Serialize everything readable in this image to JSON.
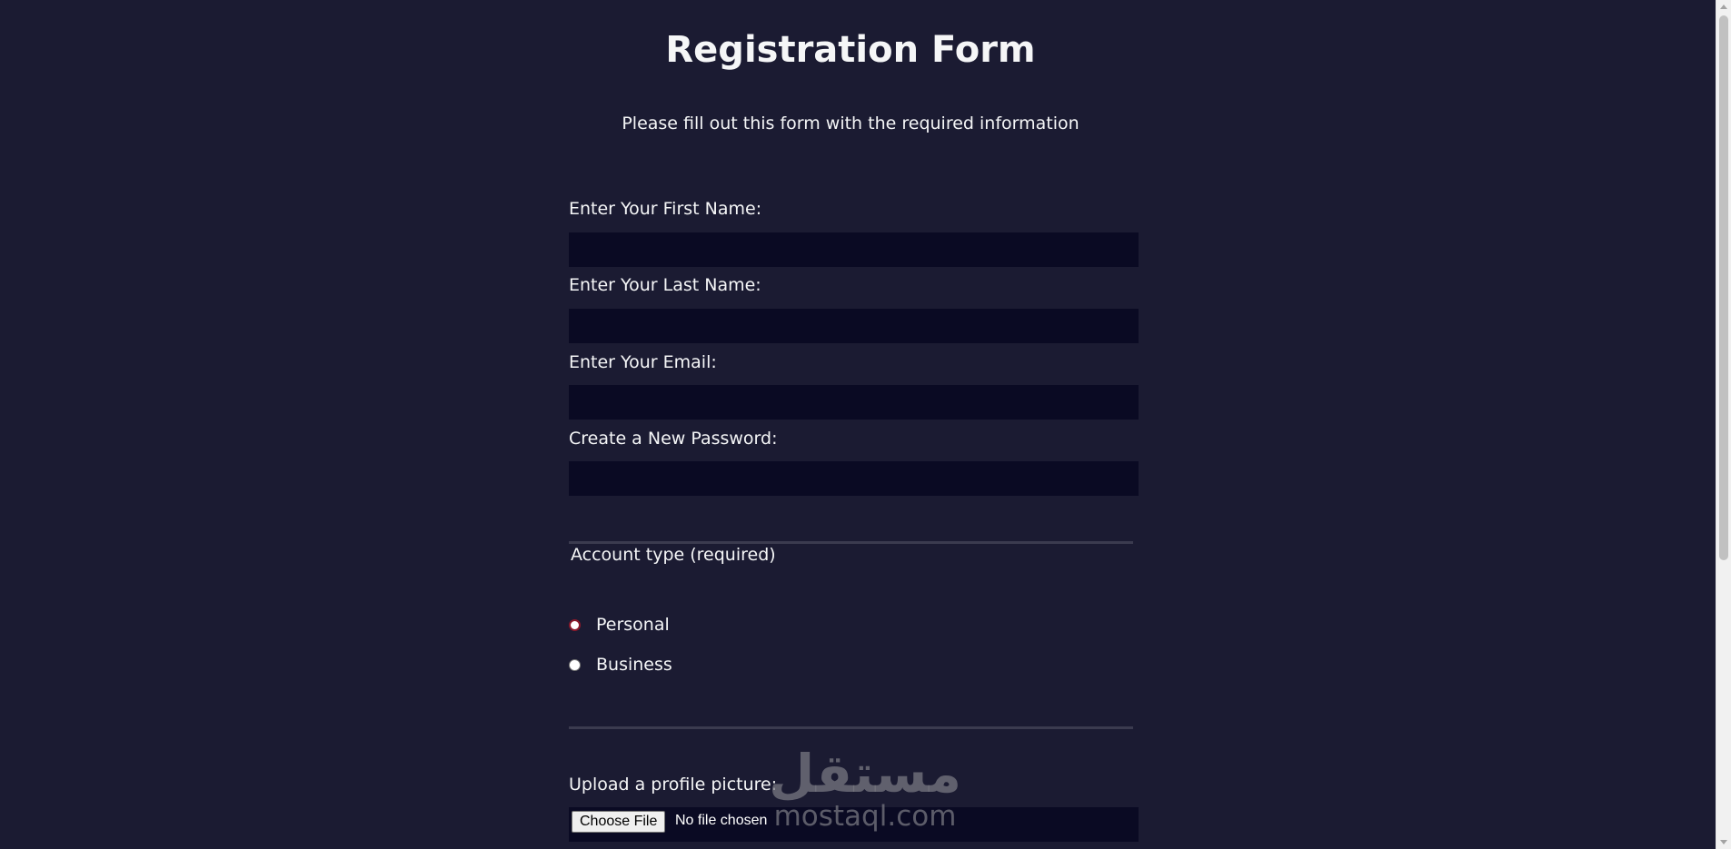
{
  "page": {
    "title": "Registration Form",
    "subtitle": "Please fill out this form with the required information"
  },
  "fields": {
    "first_name": {
      "label": "Enter Your First Name:",
      "value": ""
    },
    "last_name": {
      "label": "Enter Your Last Name:",
      "value": ""
    },
    "email": {
      "label": "Enter Your Email:",
      "value": ""
    },
    "password": {
      "label": "Create a New Password:",
      "value": ""
    }
  },
  "account_type": {
    "legend": "Account type (required)",
    "options": [
      {
        "label": "Personal",
        "checked": true
      },
      {
        "label": "Business",
        "checked": false
      }
    ]
  },
  "upload": {
    "label": "Upload a profile picture:",
    "button_label": "Choose File",
    "status": "No file chosen"
  },
  "watermark": {
    "arabic": "مستقل",
    "latin": "mostaql.com"
  },
  "colors": {
    "background": "#1b1b32",
    "input_background": "#0a0a23",
    "text": "#f5f6f7",
    "divider": "#3b3b4f",
    "radio_checked_border": "#8b1a2b"
  }
}
